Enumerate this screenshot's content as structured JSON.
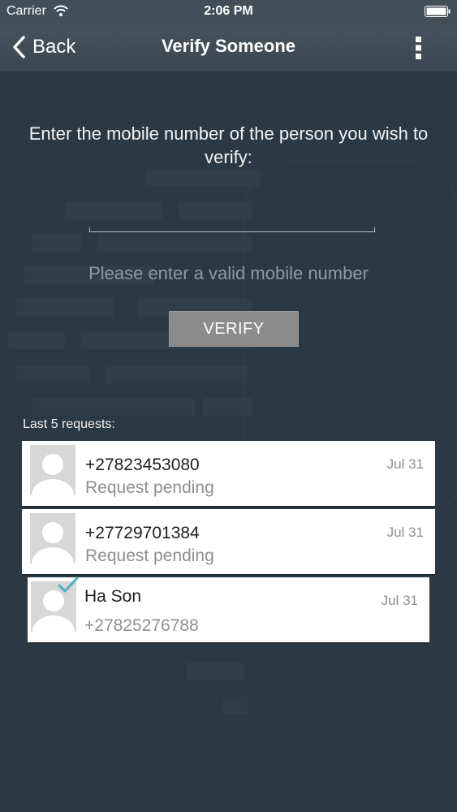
{
  "status_bar": {
    "carrier": "Carrier",
    "time": "2:06 PM"
  },
  "nav": {
    "back_label": "Back",
    "title": "Verify Someone"
  },
  "form": {
    "prompt": "Enter the mobile number of the person you wish to verify:",
    "phone_value": "",
    "validation_message": "Please enter a valid mobile number",
    "verify_label": "VERIFY"
  },
  "requests": {
    "heading": "Last 5 requests:",
    "items": [
      {
        "title": "+27823453080",
        "subtitle": "Request pending",
        "date": "Jul 31",
        "verified": false
      },
      {
        "title": "+27729701384",
        "subtitle": "Request pending",
        "date": "Jul 31",
        "verified": false
      },
      {
        "title": "Ha Son",
        "subtitle": "+27825276788",
        "date": "Jul 31",
        "verified": true
      }
    ]
  },
  "colors": {
    "background": "#2b3944",
    "nav_bar": "#3f4c56",
    "button": "#8b8b8b",
    "check_accent": "#4fb0c6"
  },
  "icons": [
    "wifi-icon",
    "battery-icon",
    "back-chevron-icon",
    "more-vertical-icon",
    "avatar-placeholder-icon",
    "checkmark-icon"
  ]
}
